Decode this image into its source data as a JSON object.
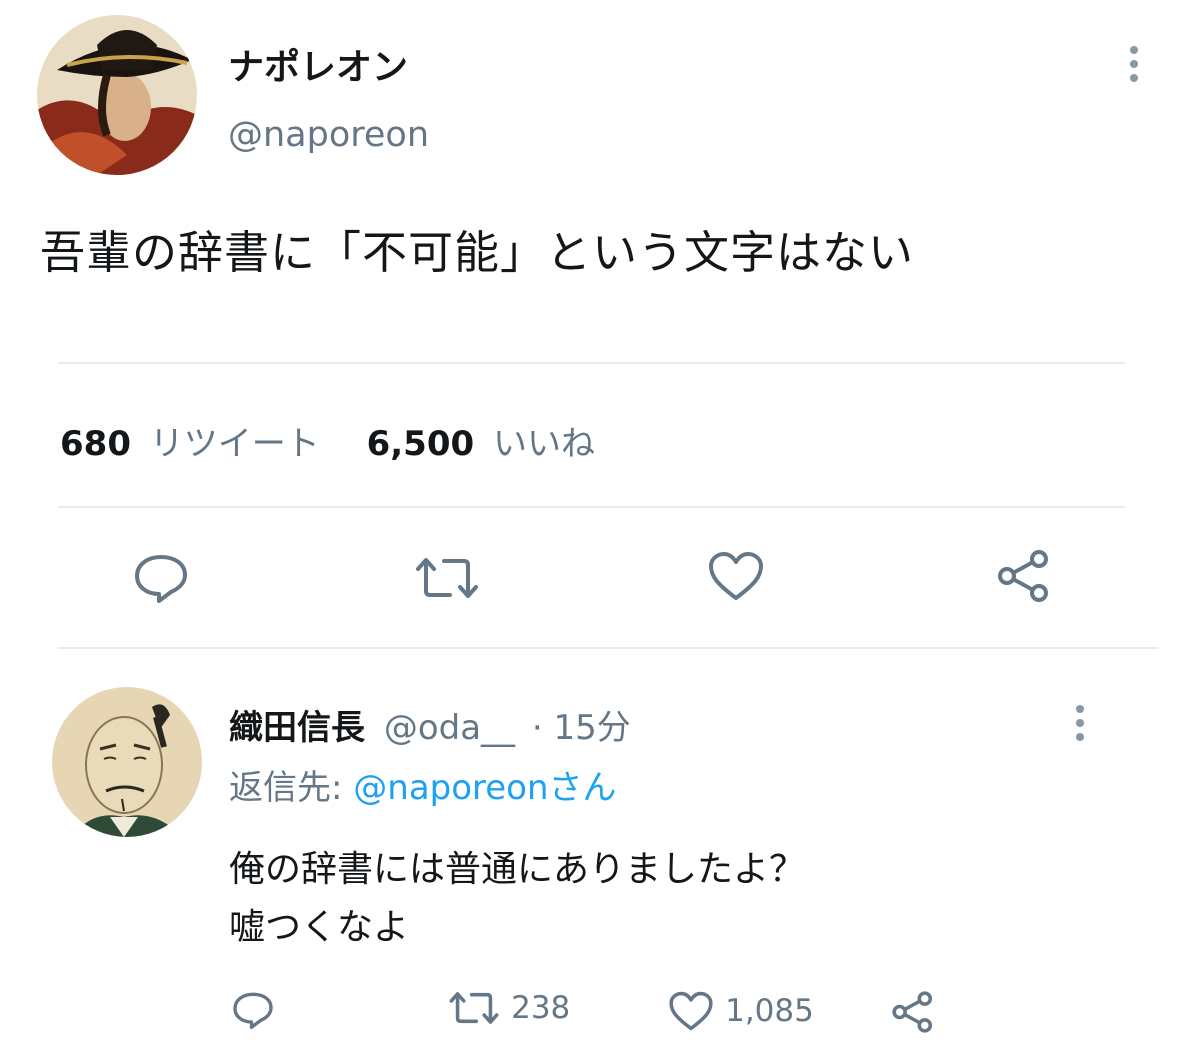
{
  "tweet": {
    "author_name": "ナポレオン",
    "author_handle": "@naporeon",
    "text": "吾輩の辞書に「不可能」という文字はない",
    "retweet_count": "680",
    "retweet_label": "リツイート",
    "like_count": "6,500",
    "like_label": "いいね",
    "actions": [
      "reply-icon",
      "retweet-icon",
      "like-icon",
      "share-icon"
    ]
  },
  "reply": {
    "author_name": "織田信長",
    "author_handle": "@oda__",
    "time": "· 15分",
    "reply_to_prefix": "返信先: ",
    "reply_to_handle": "@naporeon",
    "reply_to_suffix": "さん",
    "text_line1": "俺の辞書には普通にありましたよ？",
    "text_line2": "嘘つくなよ",
    "retweet_count": "238",
    "like_count": "1,085"
  },
  "colors": {
    "text": "#14171a",
    "secondary": "#657786",
    "link": "#1da1f2",
    "divider": "#e6ecf0"
  }
}
